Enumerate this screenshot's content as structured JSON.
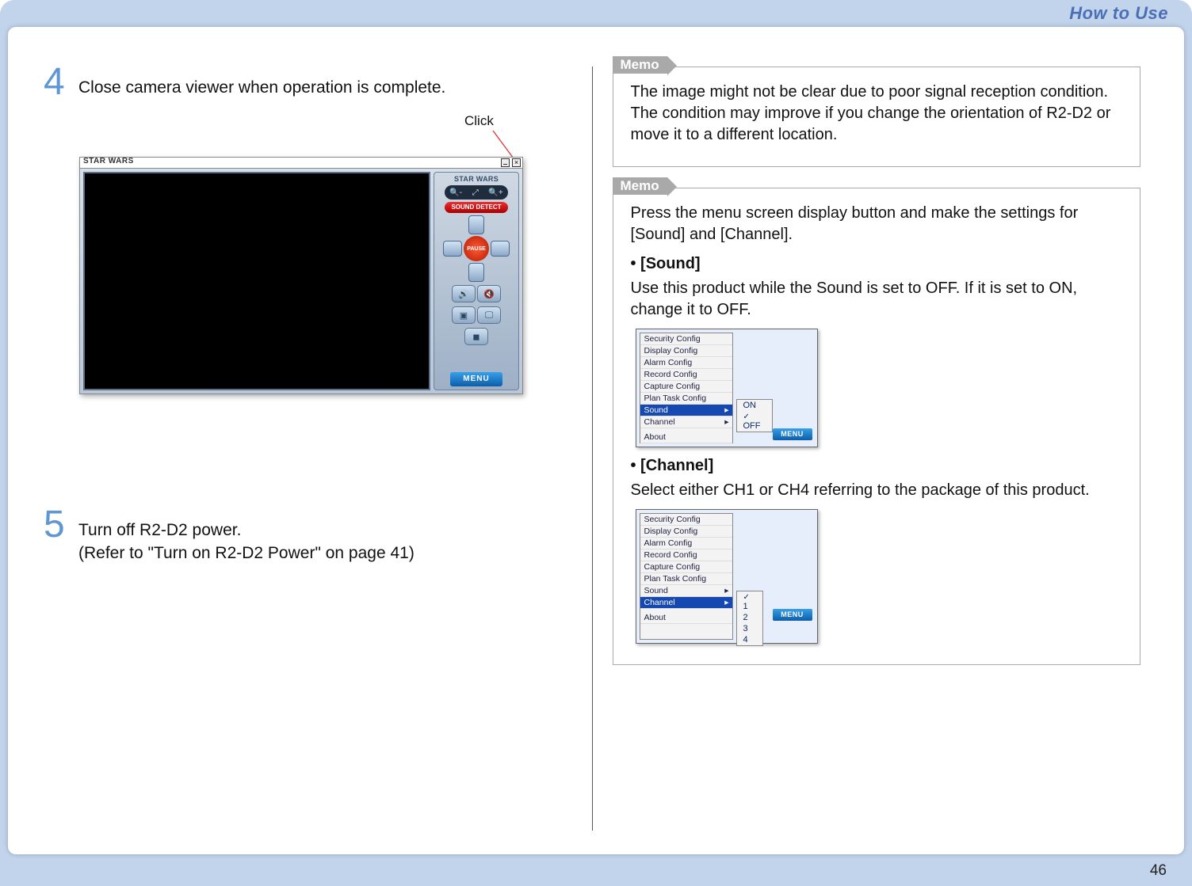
{
  "header": {
    "title": "How to Use"
  },
  "left": {
    "step4": {
      "num": "4",
      "text": "Close camera viewer when operation is complete."
    },
    "click_label": "Click",
    "viewer": {
      "title": "STAR WARS",
      "panel_logo": "STAR WARS",
      "sound_detect": "SOUND DETECT",
      "pause": "PAUSE",
      "menu": "MENU"
    },
    "step5": {
      "num": "5",
      "line1": "Turn off R2-D2 power.",
      "line2": "(Refer to \"Turn on R2-D2 Power\" on page 41)"
    }
  },
  "right": {
    "memo_label": "Memo",
    "memo1": "The image might not be clear due to poor signal reception condition. The condition may improve if you change the orientation of R2-D2 or move it to a different location.",
    "memo2_intro": "Press the menu screen display button and make the settings for [Sound] and [Channel].",
    "sound_h": "• [Sound]",
    "sound_p": "Use this product while the Sound is set to OFF. If it is set to ON, change it to OFF.",
    "channel_h": "• [Channel]",
    "channel_p": "Select either CH1 or CH4 referring to the package of this product.",
    "menu_items": {
      "security": "Security Config",
      "display": "Display Config",
      "alarm": "Alarm Config",
      "record": "Record Config",
      "capture": "Capture Config",
      "plan": "Plan Task Config",
      "sound": "Sound",
      "channel": "Channel",
      "about": "About"
    },
    "sound_options": {
      "on": "ON",
      "off": "OFF"
    },
    "channel_options": {
      "c1": "1",
      "c2": "2",
      "c3": "3",
      "c4": "4"
    },
    "mini_menu_btn": "MENU"
  },
  "page_number": "46"
}
